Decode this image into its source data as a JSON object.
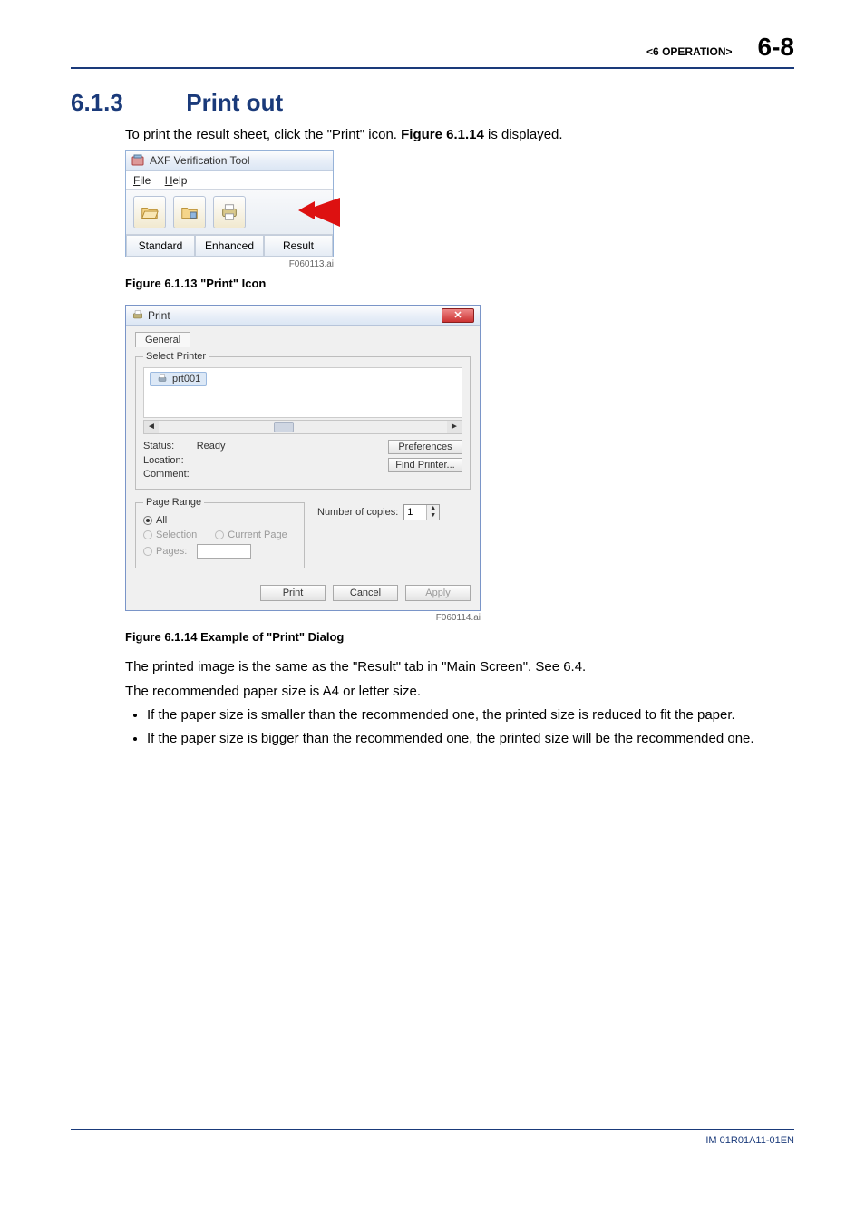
{
  "header": {
    "section_label": "<6  OPERATION>",
    "page_number": "6-8"
  },
  "section": {
    "number": "6.1.3",
    "title": "Print out"
  },
  "intro": {
    "pre": "To print the result sheet, click the \"Print\" icon. ",
    "bold": "Figure 6.1.14",
    "post": " is displayed."
  },
  "fig1": {
    "app_title": "AXF Verification Tool",
    "menu_file": "File",
    "menu_help": "Help",
    "tab_standard": "Standard",
    "tab_enhanced": "Enhanced",
    "tab_result": "Result",
    "tag": "F060113.ai",
    "caption": "Figure 6.1.13 \"Print\" Icon"
  },
  "fig2": {
    "title": "Print",
    "tab_general": "General",
    "grp_select_printer": "Select Printer",
    "printer_name": "prt001",
    "status_label": "Status:",
    "status_value": "Ready",
    "location_label": "Location:",
    "comment_label": "Comment:",
    "btn_pref": "Preferences",
    "btn_find": "Find Printer...",
    "grp_page_range": "Page Range",
    "opt_all": "All",
    "opt_selection": "Selection",
    "opt_current": "Current Page",
    "opt_pages": "Pages:",
    "copies_label": "Number of copies:",
    "copies_value": "1",
    "btn_print": "Print",
    "btn_cancel": "Cancel",
    "btn_apply": "Apply",
    "tag": "F060114.ai",
    "caption": "Figure 6.1.14 Example of \"Print\" Dialog"
  },
  "para1": "The printed image is the same as the \"Result\" tab in \"Main Screen\". See 6.4.",
  "para2": "The recommended paper size is A4 or letter size.",
  "bullet1": "If the paper size is smaller than the recommended one, the printed size is reduced to fit the paper.",
  "bullet2": "If the paper size is bigger than the recommended one, the printed size will be the recommended one.",
  "footer_doc": "IM 01R01A11-01EN"
}
